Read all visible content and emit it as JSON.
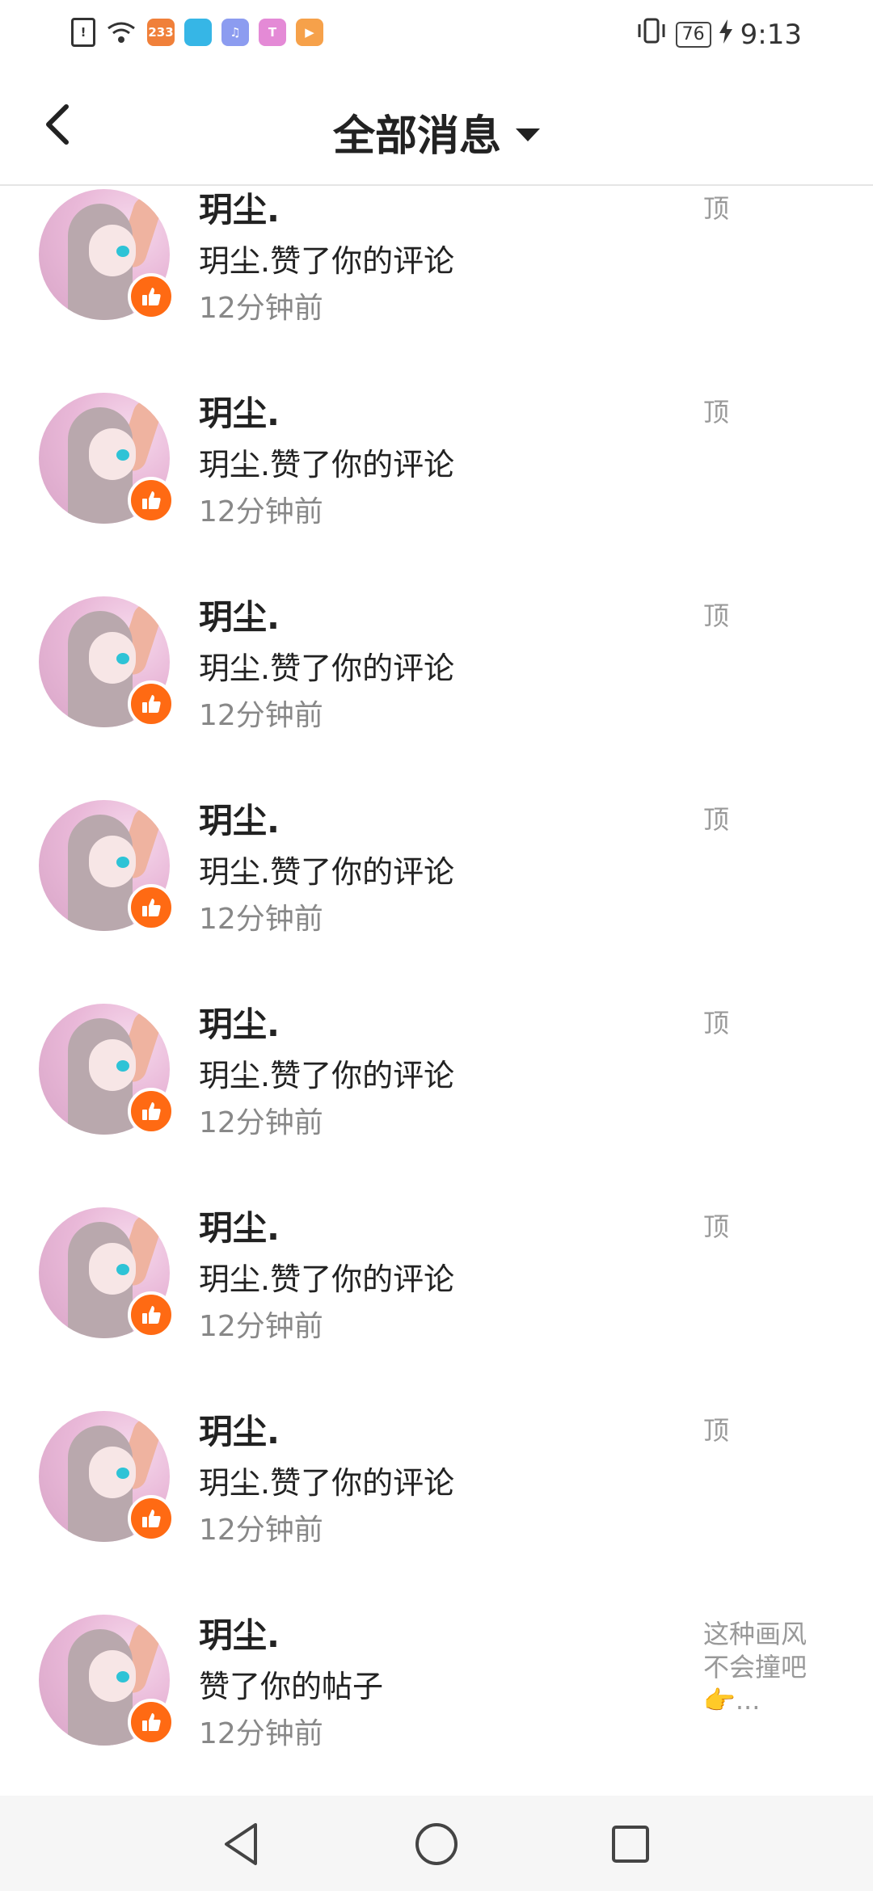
{
  "status_bar": {
    "time": "9:13",
    "battery": "76",
    "app_icons": [
      {
        "name": "notification-alert-icon",
        "color": "#ffffff",
        "label": "!"
      },
      {
        "name": "wifi-icon",
        "color": "#ffffff",
        "label": ""
      },
      {
        "name": "app-233-icon",
        "color": "#f0803a",
        "label": "233"
      },
      {
        "name": "shield-app-icon",
        "color": "#36b6e6",
        "label": ""
      },
      {
        "name": "music-app-icon",
        "color": "#8c9cf0",
        "label": "♫"
      },
      {
        "name": "colorful-app-icon",
        "color": "#e48ad6",
        "label": "T"
      },
      {
        "name": "video-app-icon",
        "color": "#f6a14a",
        "label": "▶"
      }
    ]
  },
  "header": {
    "title": "全部消息"
  },
  "messages": [
    {
      "name": "玥尘.",
      "action": "玥尘.赞了你的评论",
      "time": "12分钟前",
      "side": "顶"
    },
    {
      "name": "玥尘.",
      "action": "玥尘.赞了你的评论",
      "time": "12分钟前",
      "side": "顶"
    },
    {
      "name": "玥尘.",
      "action": "玥尘.赞了你的评论",
      "time": "12分钟前",
      "side": "顶"
    },
    {
      "name": "玥尘.",
      "action": "玥尘.赞了你的评论",
      "time": "12分钟前",
      "side": "顶"
    },
    {
      "name": "玥尘.",
      "action": "玥尘.赞了你的评论",
      "time": "12分钟前",
      "side": "顶"
    },
    {
      "name": "玥尘.",
      "action": "玥尘.赞了你的评论",
      "time": "12分钟前",
      "side": "顶"
    },
    {
      "name": "玥尘.",
      "action": "玥尘.赞了你的评论",
      "time": "12分钟前",
      "side": "顶"
    },
    {
      "name": "玥尘.",
      "action": "赞了你的帖子",
      "time": "12分钟前",
      "side": "这种画风不会撞吧👉..."
    }
  ],
  "colors": {
    "like_badge": "#ff6a13",
    "muted_text": "#888888"
  }
}
